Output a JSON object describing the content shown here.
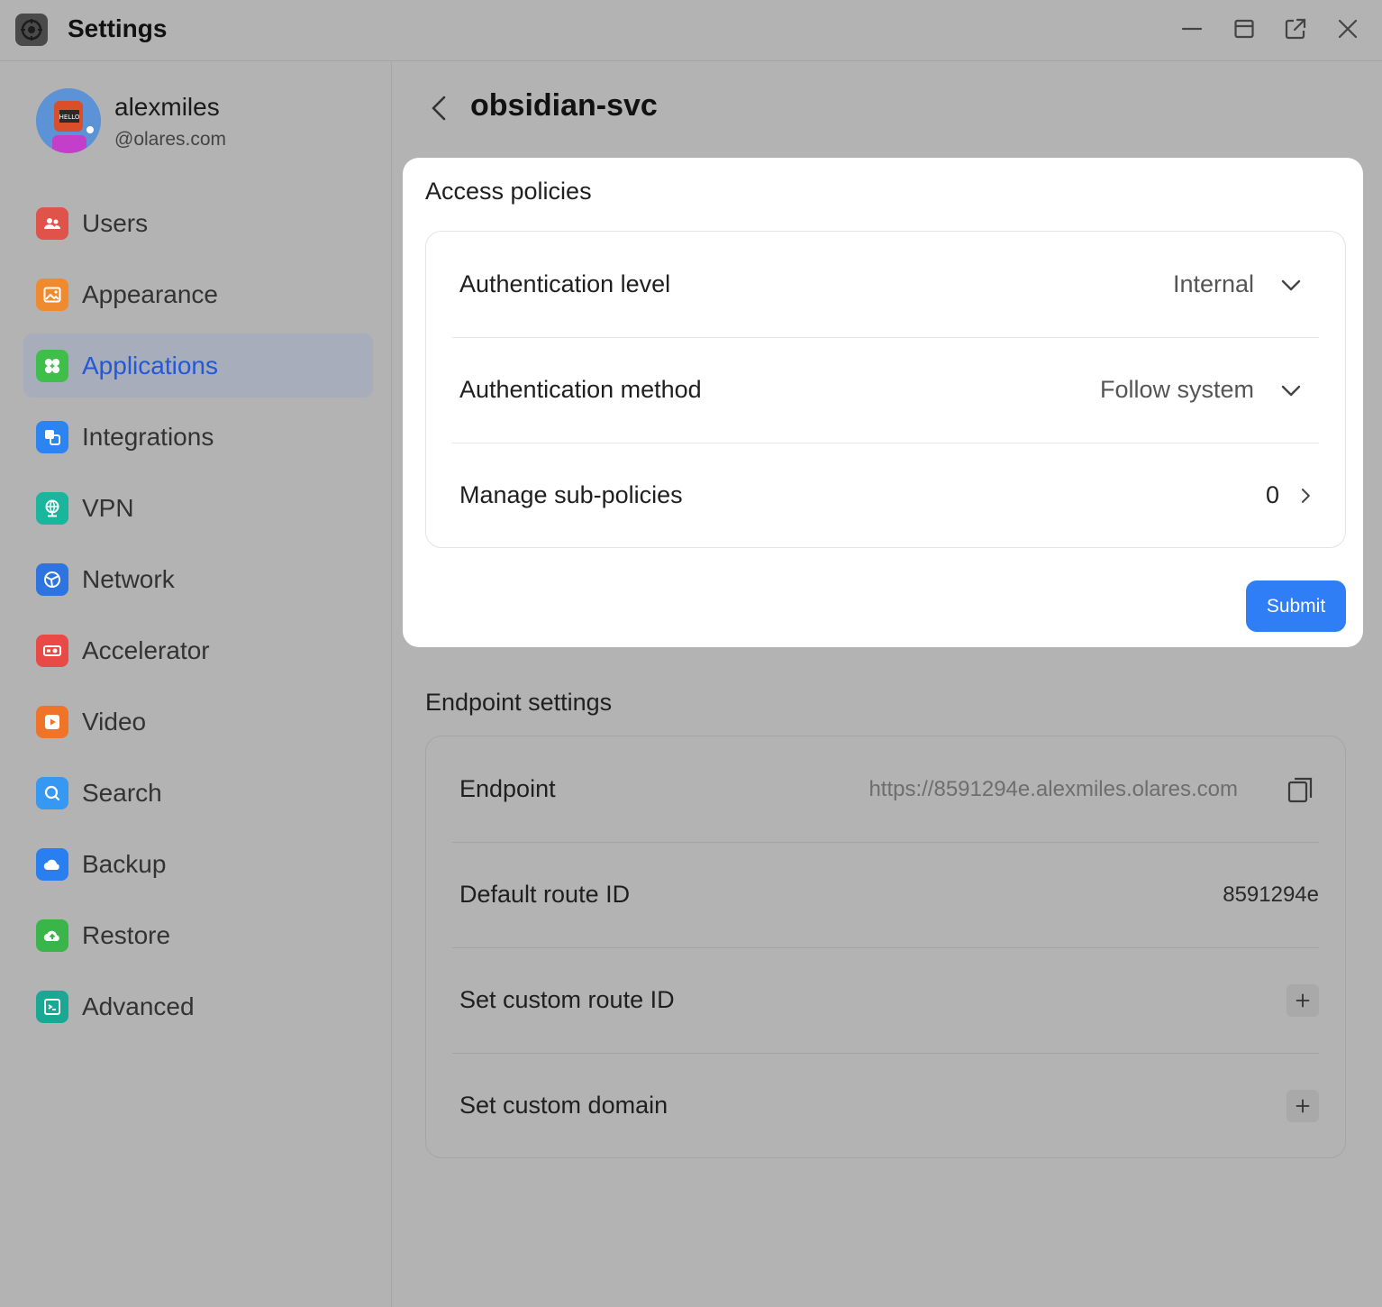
{
  "window": {
    "title": "Settings",
    "controls": [
      "minimize-icon",
      "maximize-icon",
      "popout-icon",
      "close-icon"
    ]
  },
  "user": {
    "name": "alexmiles",
    "domain": "@olares.com"
  },
  "sidebar": {
    "items": [
      {
        "label": "Users",
        "icon": "users-icon",
        "color": "#e0534a"
      },
      {
        "label": "Appearance",
        "icon": "image-icon",
        "color": "#ef8a2e"
      },
      {
        "label": "Applications",
        "icon": "clover-icon",
        "color": "#3fbf4a",
        "active": true
      },
      {
        "label": "Integrations",
        "icon": "squares-icon",
        "color": "#2c84f0"
      },
      {
        "label": "VPN",
        "icon": "globe-icon",
        "color": "#19b59c"
      },
      {
        "label": "Network",
        "icon": "network-icon",
        "color": "#2d74e0"
      },
      {
        "label": "Accelerator",
        "icon": "gpu-icon",
        "color": "#ea4a45"
      },
      {
        "label": "Video",
        "icon": "play-icon",
        "color": "#f07427"
      },
      {
        "label": "Search",
        "icon": "search-icon",
        "color": "#3798f2"
      },
      {
        "label": "Backup",
        "icon": "cloud-icon",
        "color": "#2a7ff0"
      },
      {
        "label": "Restore",
        "icon": "cloud-upload-icon",
        "color": "#39b549"
      },
      {
        "label": "Advanced",
        "icon": "terminal-icon",
        "color": "#1aa895"
      }
    ]
  },
  "page": {
    "title": "obsidian-svc"
  },
  "access_policies": {
    "title": "Access policies",
    "auth_level": {
      "label": "Authentication level",
      "value": "Internal"
    },
    "auth_method": {
      "label": "Authentication method",
      "value": "Follow system"
    },
    "sub_policies": {
      "label": "Manage sub-policies",
      "count": "0"
    },
    "submit_label": "Submit"
  },
  "endpoint_settings": {
    "title": "Endpoint settings",
    "endpoint": {
      "label": "Endpoint",
      "value": "https://8591294e.alexmiles.olares.com"
    },
    "default_route": {
      "label": "Default route ID",
      "value": "8591294e"
    },
    "custom_route": {
      "label": "Set custom route ID"
    },
    "custom_domain": {
      "label": "Set custom domain"
    }
  },
  "colors": {
    "accent": "#2f7ef5",
    "active_nav_text": "#2358d6",
    "overlay_bg": "#b3b3b3"
  }
}
